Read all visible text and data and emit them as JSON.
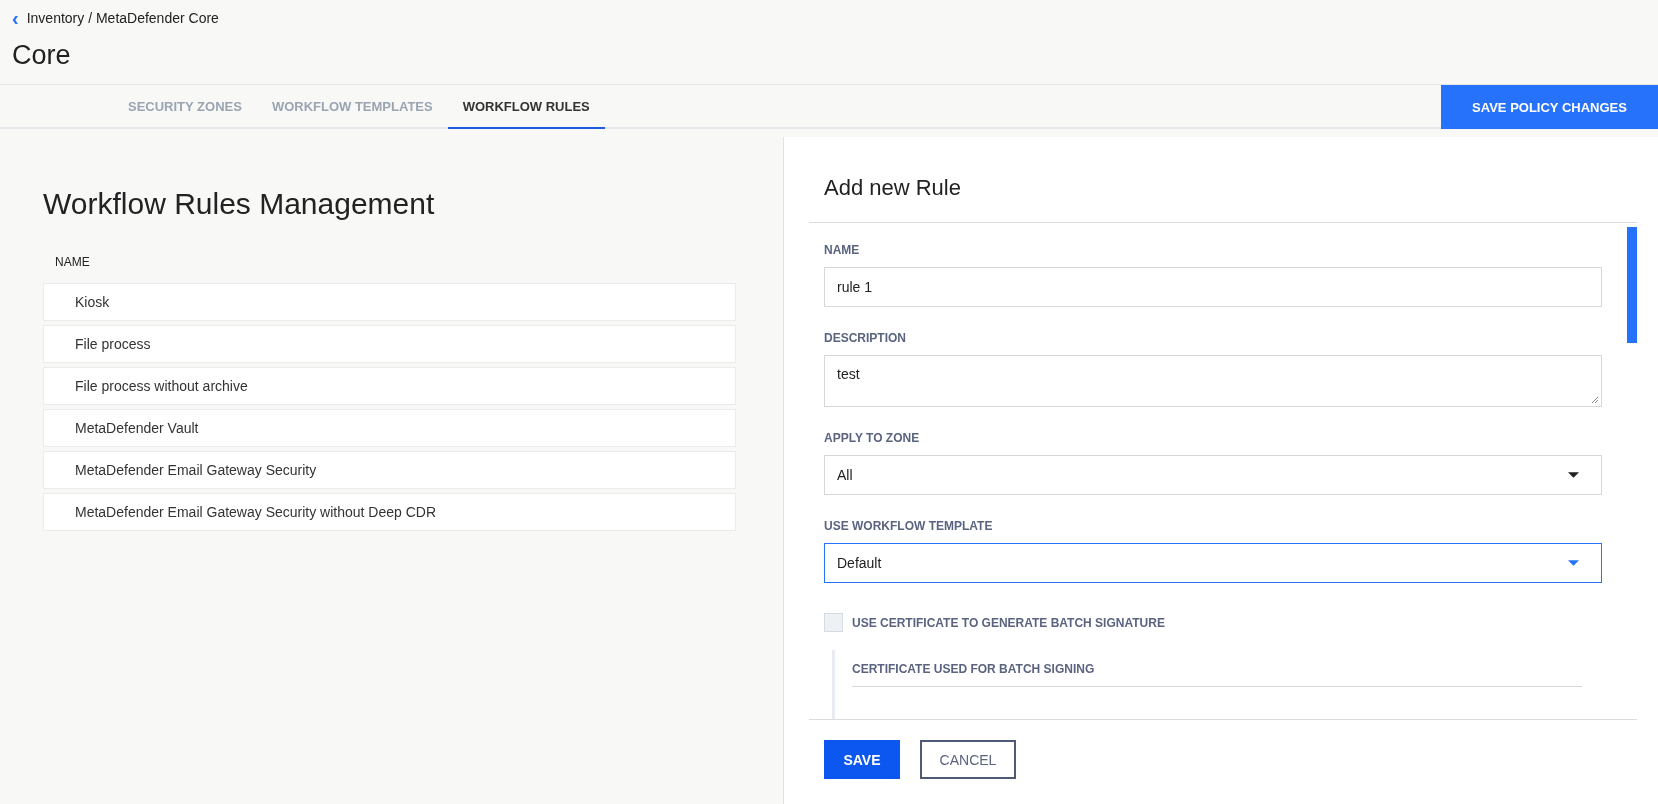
{
  "breadcrumb": {
    "back_icon": "‹",
    "path": "Inventory / MetaDefender Core"
  },
  "page_title": "Core",
  "tabs": [
    {
      "label": "SECURITY ZONES",
      "selected": false
    },
    {
      "label": "WORKFLOW TEMPLATES",
      "selected": false
    },
    {
      "label": "WORKFLOW RULES",
      "selected": true
    }
  ],
  "save_policy_button": "SAVE POLICY CHANGES",
  "rules_panel": {
    "title": "Workflow Rules Management",
    "column": "NAME",
    "rows": [
      {
        "name": "Kiosk"
      },
      {
        "name": "File process"
      },
      {
        "name": "File process without archive"
      },
      {
        "name": "MetaDefender Vault"
      },
      {
        "name": "MetaDefender Email Gateway Security"
      },
      {
        "name": "MetaDefender Email Gateway Security without Deep CDR"
      }
    ]
  },
  "form": {
    "title": "Add new Rule",
    "fields": [
      {
        "kind": "text",
        "label": "NAME",
        "value": "rule 1",
        "focused": false
      },
      {
        "kind": "textarea",
        "label": "DESCRIPTION",
        "value": "test",
        "focused": false
      },
      {
        "kind": "select",
        "label": "APPLY TO ZONE",
        "value": "All",
        "focused": false
      },
      {
        "kind": "select",
        "label": "USE WORKFLOW TEMPLATE",
        "value": "Default",
        "focused": true
      },
      {
        "kind": "checkbox",
        "label": "USE CERTIFICATE TO GENERATE BATCH SIGNATURE",
        "checked": false
      },
      {
        "kind": "subfield",
        "label": "CERTIFICATE USED FOR BATCH SIGNING"
      }
    ],
    "buttons": {
      "save": "SAVE",
      "cancel": "CANCEL"
    }
  }
}
